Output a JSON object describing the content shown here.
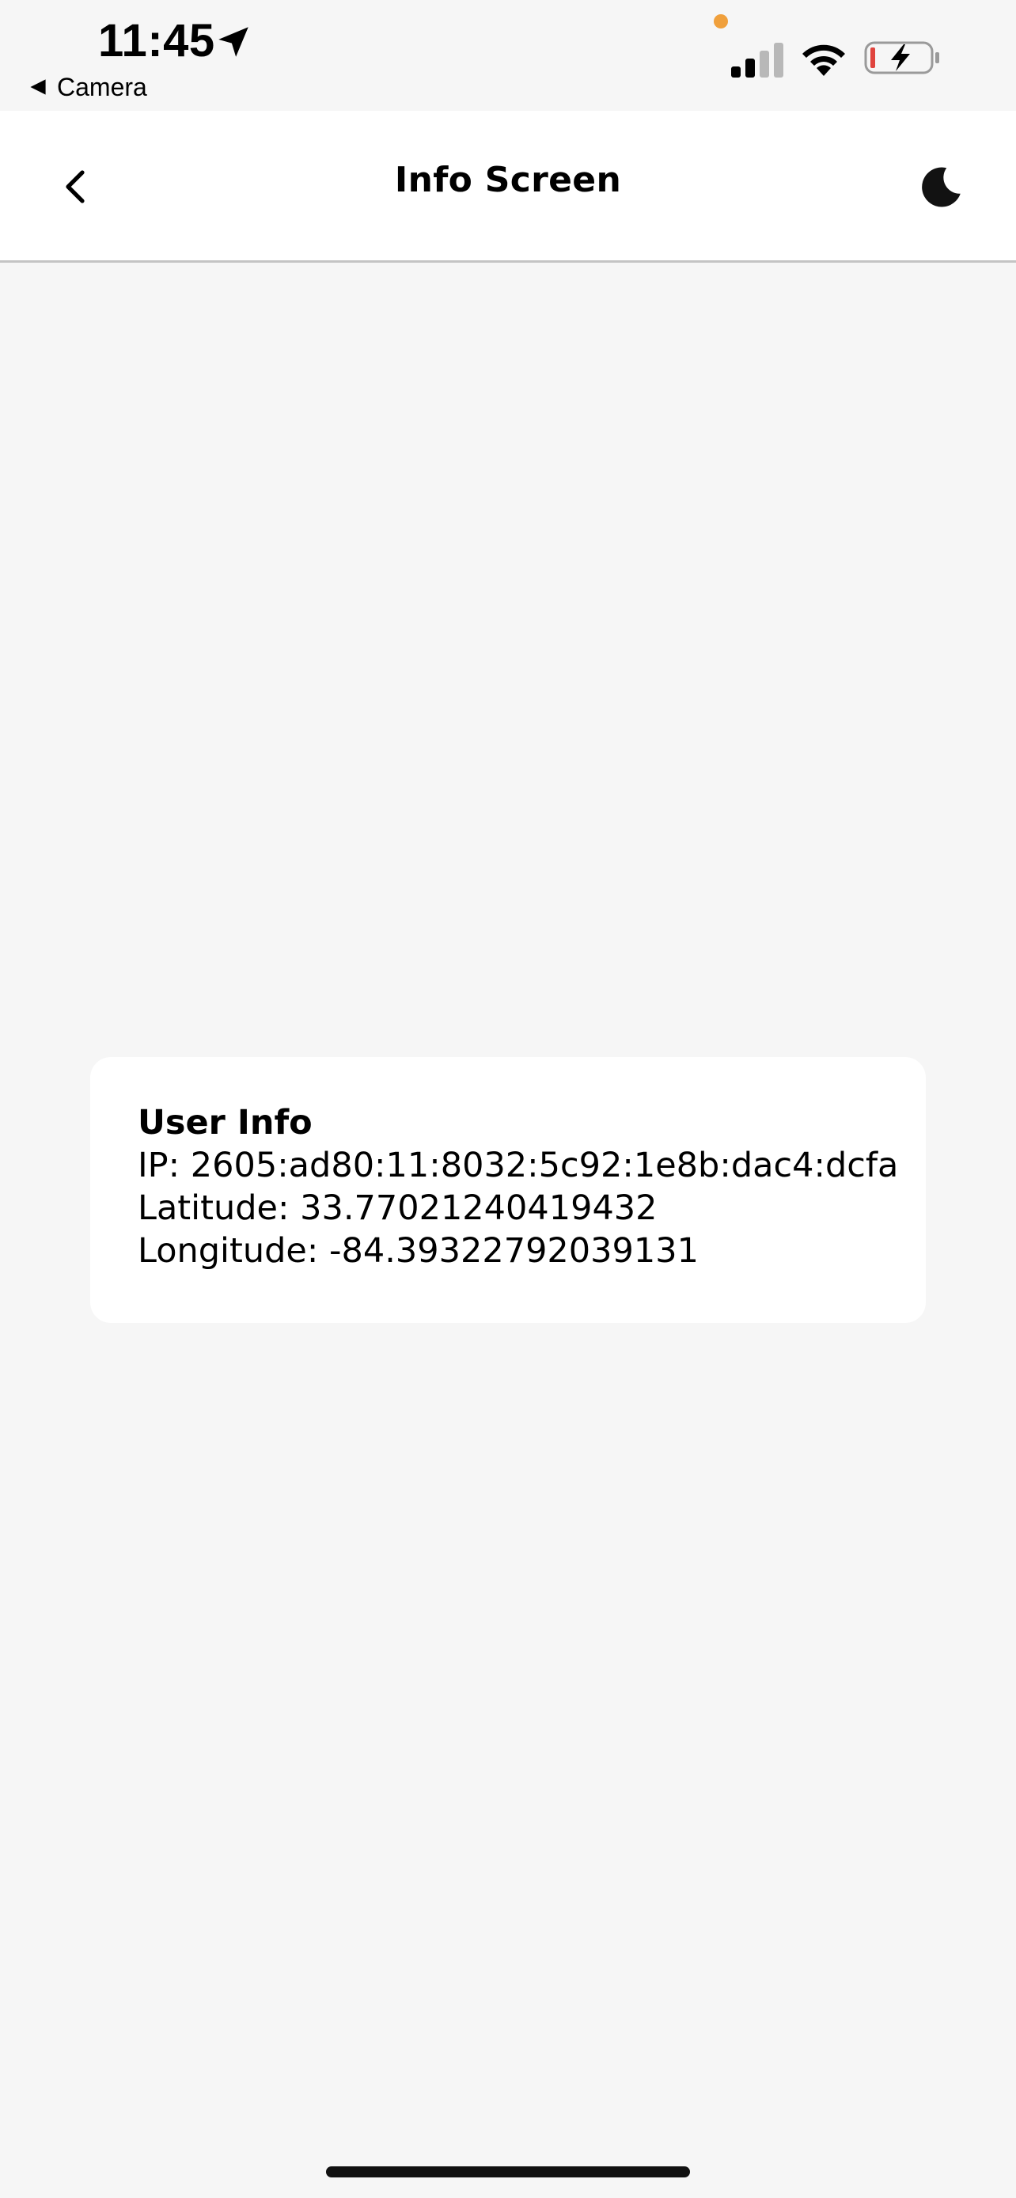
{
  "status_bar": {
    "time": "11:45",
    "back_app_label": "Camera",
    "icons": {
      "location": "location-arrow-icon",
      "signal": "cellular-signal-icon",
      "wifi": "wifi-icon",
      "battery": "battery-charging-icon"
    },
    "colors": {
      "privacy_dot": "#f0a03c",
      "battery_low": "#e0443e"
    }
  },
  "header": {
    "title": "Info Screen",
    "back_icon": "chevron-left-icon",
    "theme_icon": "moon-icon"
  },
  "card": {
    "title": "User Info",
    "ip_line": "IP: 2605:ad80:11:8032:5c92:1e8b:dac4:dcfa",
    "latitude_line": "Latitude: 33.77021240419432",
    "longitude_line": "Longitude: -84.39322792039131"
  }
}
